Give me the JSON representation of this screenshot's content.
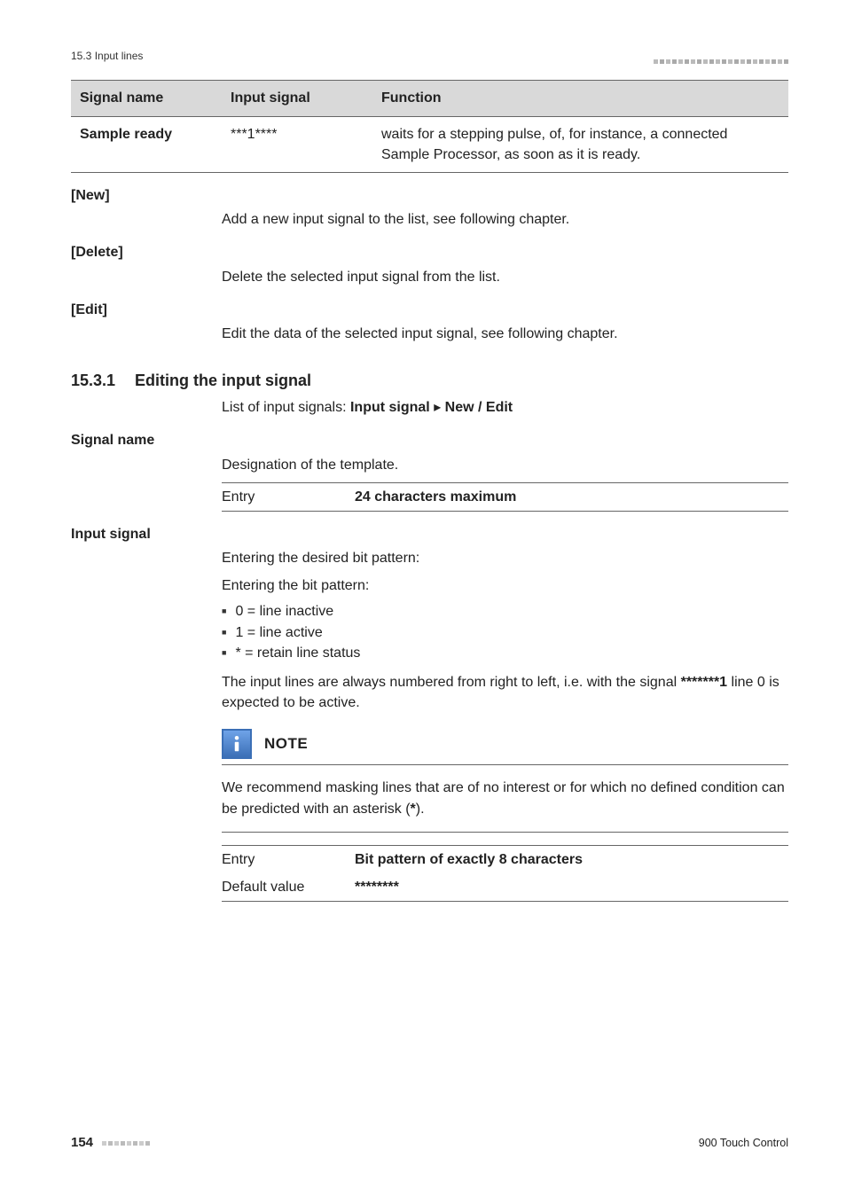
{
  "header": {
    "section_ref": "15.3 Input lines"
  },
  "table": {
    "headers": [
      "Signal name",
      "Input signal",
      "Function"
    ],
    "row": {
      "name": "Sample ready",
      "signal": "***1****",
      "func": "waits for a stepping pulse, of, for instance, a connected Sample Processor, as soon as it is ready."
    }
  },
  "terms": {
    "new": {
      "label": "[New]",
      "body": "Add a new input signal to the list, see following chapter."
    },
    "delete": {
      "label": "[Delete]",
      "body": "Delete the selected input signal from the list."
    },
    "edit": {
      "label": "[Edit]",
      "body": "Edit the data of the selected input signal, see following chapter."
    }
  },
  "section": {
    "num": "15.3.1",
    "title": "Editing the input signal",
    "lead_prefix": "List of input signals: ",
    "lead_bold1": "Input signal",
    "lead_sep": " ▸ ",
    "lead_bold2": "New / Edit"
  },
  "signal_name": {
    "label": "Signal name",
    "desc": "Designation of the template.",
    "entry_label": "Entry",
    "entry_value": "24 characters maximum"
  },
  "input_signal": {
    "label": "Input signal",
    "l1": "Entering the desired bit pattern:",
    "l2": "Entering the bit pattern:",
    "bul": [
      "0 = line inactive",
      "1 = line active",
      "* = retain line status"
    ],
    "para_prefix": "The input lines are always numbered from right to left, i.e. with the signal ",
    "para_code": "*******1",
    "para_suffix": " line 0 is expected to be active."
  },
  "note": {
    "title": "NOTE",
    "body_prefix": "We recommend masking lines that are of no interest or for which no defined condition can be predicted with an asterisk (",
    "body_bold": "*",
    "body_suffix": ")."
  },
  "entry2": {
    "entry_label": "Entry",
    "entry_value": "Bit pattern of exactly 8 characters",
    "default_label": "Default value",
    "default_value": "********"
  },
  "footer": {
    "page": "154",
    "product": "900 Touch Control"
  }
}
